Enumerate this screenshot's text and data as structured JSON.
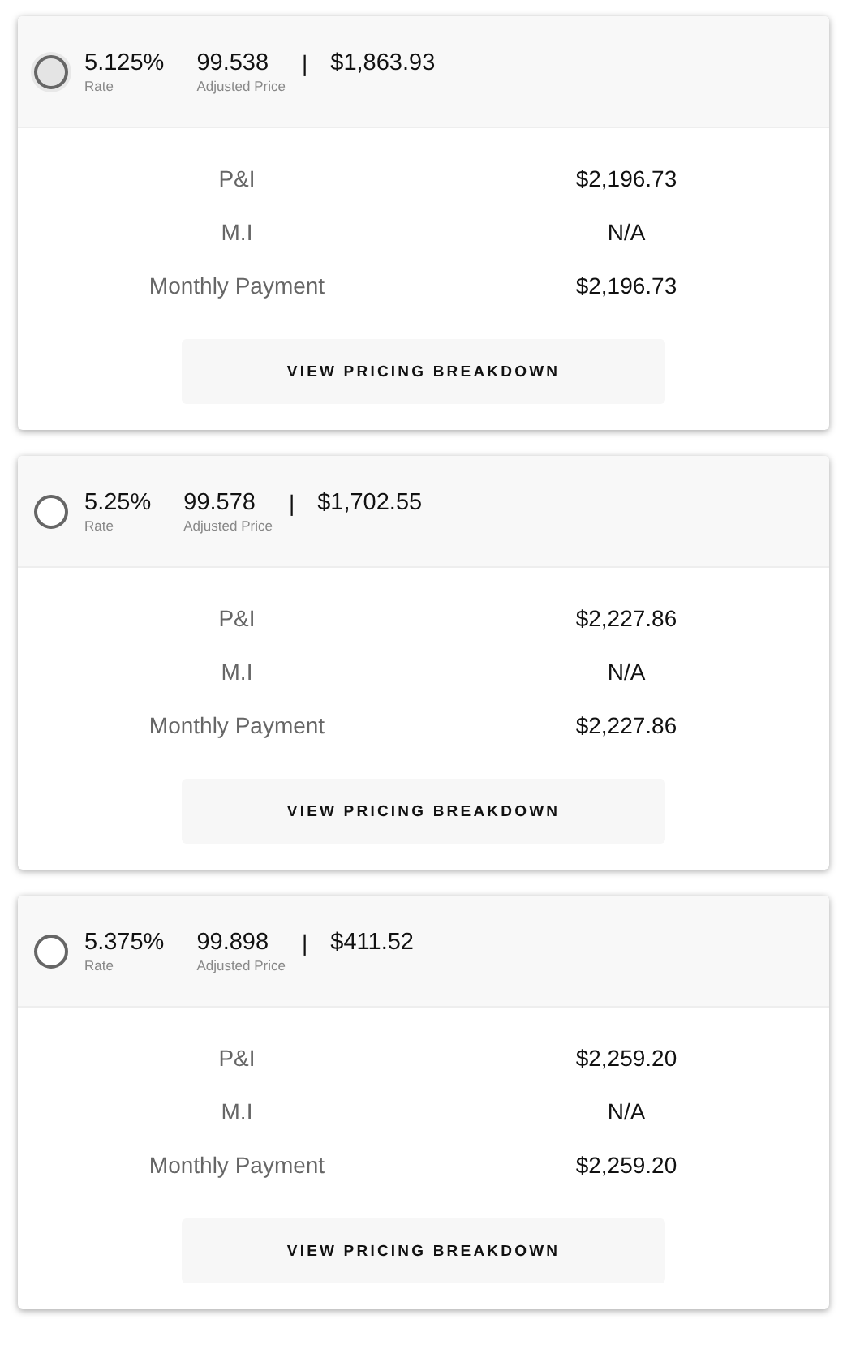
{
  "options": [
    {
      "selected": false,
      "hovered": true,
      "rate": "5.125%",
      "rate_label": "Rate",
      "price": "99.538",
      "price_label": "Adjusted Price",
      "separator": "|",
      "cost": "$1,863.93",
      "rows": [
        {
          "label": "P&I",
          "value": "$2,196.73"
        },
        {
          "label": "M.I",
          "value": "N/A"
        },
        {
          "label": "Monthly Payment",
          "value": "$2,196.73"
        }
      ],
      "button": "VIEW PRICING BREAKDOWN"
    },
    {
      "selected": false,
      "hovered": false,
      "rate": "5.25%",
      "rate_label": "Rate",
      "price": "99.578",
      "price_label": "Adjusted Price",
      "separator": "|",
      "cost": "$1,702.55",
      "rows": [
        {
          "label": "P&I",
          "value": "$2,227.86"
        },
        {
          "label": "M.I",
          "value": "N/A"
        },
        {
          "label": "Monthly Payment",
          "value": "$2,227.86"
        }
      ],
      "button": "VIEW PRICING BREAKDOWN"
    },
    {
      "selected": false,
      "hovered": false,
      "rate": "5.375%",
      "rate_label": "Rate",
      "price": "99.898",
      "price_label": "Adjusted Price",
      "separator": "|",
      "cost": "$411.52",
      "rows": [
        {
          "label": "P&I",
          "value": "$2,259.20"
        },
        {
          "label": "M.I",
          "value": "N/A"
        },
        {
          "label": "Monthly Payment",
          "value": "$2,259.20"
        }
      ],
      "button": "VIEW PRICING BREAKDOWN"
    }
  ]
}
